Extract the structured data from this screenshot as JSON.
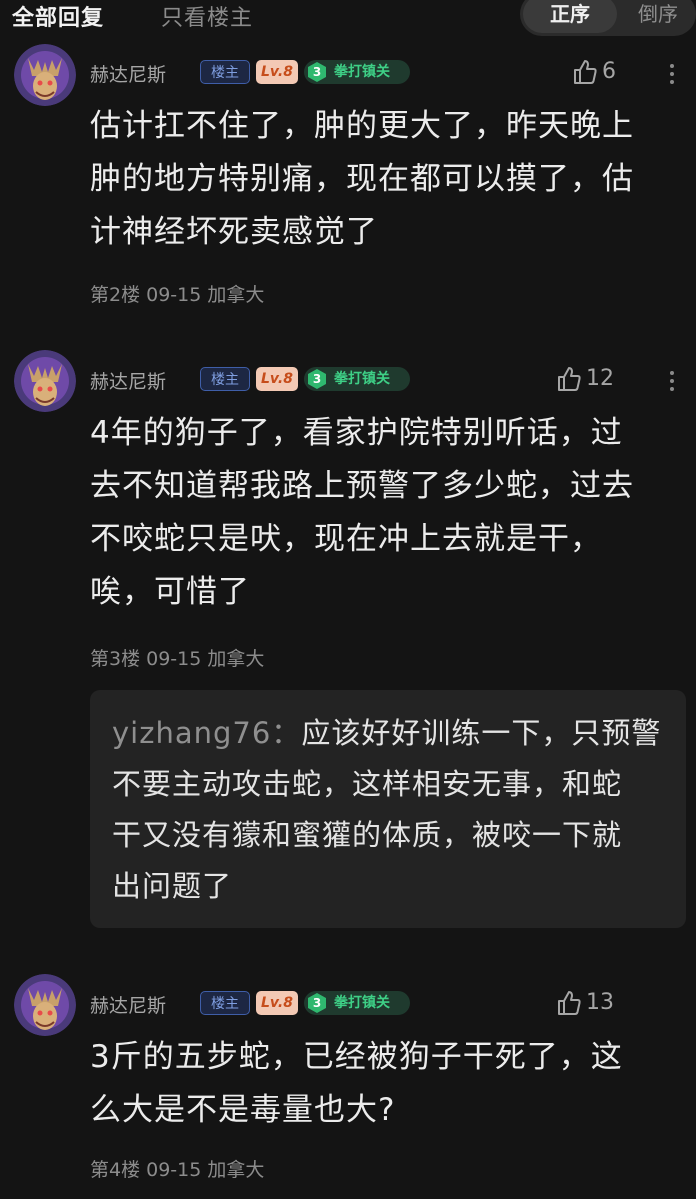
{
  "tabs": {
    "all_replies": "全部回复",
    "only_op": "只看楼主"
  },
  "sort": {
    "ascending": "正序",
    "descending": "倒序",
    "selected": "正序"
  },
  "badges": {
    "op": "楼主",
    "level": "Lv.8",
    "title_level": "3",
    "title": "拳打镇关"
  },
  "colors": {
    "background": "#141414",
    "op_badge": "#3f5ea8",
    "level_badge": "#f3c9b4",
    "title_badge": "#3ecf86"
  },
  "comments": [
    {
      "username": "赫达尼斯",
      "likes": "6",
      "lines": [
        "估计扛不住了，肿的更大了，昨天晚上",
        "肿的地方特别痛，现在都可以摸了，估",
        "计神经坏死卖感觉了"
      ],
      "meta": "第2楼  09-15  加拿大"
    },
    {
      "username": "赫达尼斯",
      "likes": "12",
      "lines": [
        "4年的狗子了，看家护院特别听话，过",
        "去不知道帮我路上预警了多少蛇，过去",
        "不咬蛇只是吠，现在冲上去就是干，",
        "唉，可惜了"
      ],
      "meta": "第3楼  09-15  加拿大",
      "reply": {
        "user": "yizhang76",
        "separator": "：",
        "lines": [
          "应该好好训练一下，只预警",
          "不要主动攻击蛇，这样相安无事，和蛇",
          "干又没有獴和蜜獾的体质，被咬一下就",
          "出问题了"
        ]
      }
    },
    {
      "username": "赫达尼斯",
      "likes": "13",
      "lines": [
        "3斤的五步蛇，已经被狗子干死了，这",
        "么大是不是毒量也大?"
      ],
      "meta": "第4楼  09-15  加拿大"
    }
  ]
}
